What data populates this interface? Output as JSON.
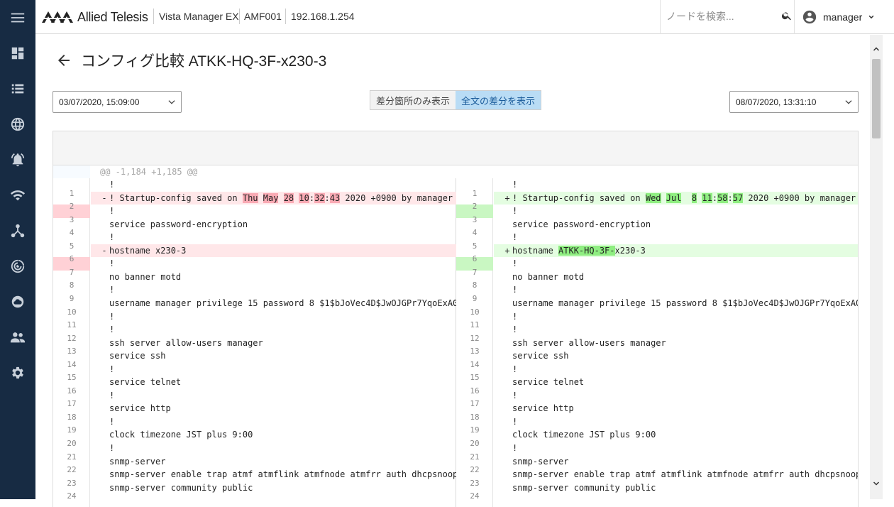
{
  "app": {
    "brand": "Allied Telesis",
    "product": "Vista Manager EX",
    "device": "AMF001",
    "ip": "192.168.1.254"
  },
  "search": {
    "placeholder": "ノードを検索..."
  },
  "user": {
    "name": "manager"
  },
  "sidebar": {
    "items": [
      "menu-icon",
      "dashboard-icon",
      "list-icon",
      "globe-icon",
      "alarm-icon",
      "wifi-icon",
      "topology-icon",
      "radar-icon",
      "cloud-icon",
      "users-icon",
      "settings-icon"
    ]
  },
  "page": {
    "title": "コンフィグ比較 ATKK-HQ-3F-x230-3",
    "left_date": "03/07/2020, 15:09:00",
    "right_date": "08/07/2020, 13:31:10",
    "toggle_diff_only": "差分箇所のみ表示",
    "toggle_full": "全文の差分を表示",
    "hunk": "@@ -1,184 +1,185 @@"
  },
  "colors": {
    "sidebar": "#172b43",
    "del_bg": "#ffe7e9",
    "add_bg": "#e4fde1",
    "del_hl": "#f9aab4",
    "add_hl": "#8fee81",
    "toggle_on": "#b9dcf5"
  },
  "diff": {
    "left": [
      {
        "n": "",
        "t": "!",
        "k": "ctx"
      },
      {
        "n": "1",
        "t": "! Startup-config saved on Thu May 28 10:32:43 2020 +0900 by manager",
        "k": "del"
      },
      {
        "n": "2",
        "t": "!",
        "k": "ctx"
      },
      {
        "n": "3",
        "t": "service password-encryption",
        "k": "ctx"
      },
      {
        "n": "4",
        "t": "!",
        "k": "ctx"
      },
      {
        "n": "5",
        "t": "hostname x230-3",
        "k": "del"
      },
      {
        "n": "6",
        "t": "!",
        "k": "ctx"
      },
      {
        "n": "7",
        "t": "no banner motd",
        "k": "ctx"
      },
      {
        "n": "8",
        "t": "!",
        "k": "ctx"
      },
      {
        "n": "9",
        "t": "username manager privilege 15 password 8 $1$bJoVec4D$JwOJGPr7YqoExA0",
        "k": "ctx"
      },
      {
        "n": "10",
        "t": "!",
        "k": "ctx"
      },
      {
        "n": "11",
        "t": "!",
        "k": "ctx"
      },
      {
        "n": "12",
        "t": "ssh server allow-users manager",
        "k": "ctx"
      },
      {
        "n": "13",
        "t": "service ssh",
        "k": "ctx"
      },
      {
        "n": "14",
        "t": "!",
        "k": "ctx"
      },
      {
        "n": "15",
        "t": "service telnet",
        "k": "ctx"
      },
      {
        "n": "16",
        "t": "!",
        "k": "ctx"
      },
      {
        "n": "17",
        "t": "service http",
        "k": "ctx"
      },
      {
        "n": "18",
        "t": "!",
        "k": "ctx"
      },
      {
        "n": "19",
        "t": "clock timezone JST plus 9:00",
        "k": "ctx"
      },
      {
        "n": "20",
        "t": "!",
        "k": "ctx"
      },
      {
        "n": "21",
        "t": "snmp-server",
        "k": "ctx"
      },
      {
        "n": "22",
        "t": "snmp-server enable trap atmf atmflink atmfnode atmfrr auth dhcpsnoop",
        "k": "ctx"
      },
      {
        "n": "23",
        "t": "snmp-server community public",
        "k": "ctx"
      },
      {
        "n": "24",
        "t": "",
        "k": "ctx"
      }
    ],
    "right": [
      {
        "n": "",
        "t": "!",
        "k": "ctx"
      },
      {
        "n": "1",
        "t": "! Startup-config saved on Wed Jul  8 11:58:57 2020 +0900 by manager",
        "k": "add"
      },
      {
        "n": "2",
        "t": "!",
        "k": "ctx"
      },
      {
        "n": "3",
        "t": "service password-encryption",
        "k": "ctx"
      },
      {
        "n": "4",
        "t": "!",
        "k": "ctx"
      },
      {
        "n": "5",
        "t": "hostname ATKK-HQ-3F-x230-3",
        "k": "add"
      },
      {
        "n": "6",
        "t": "!",
        "k": "ctx"
      },
      {
        "n": "7",
        "t": "no banner motd",
        "k": "ctx"
      },
      {
        "n": "8",
        "t": "!",
        "k": "ctx"
      },
      {
        "n": "9",
        "t": "username manager privilege 15 password 8 $1$bJoVec4D$JwOJGPr7YqoExA0",
        "k": "ctx"
      },
      {
        "n": "10",
        "t": "!",
        "k": "ctx"
      },
      {
        "n": "11",
        "t": "!",
        "k": "ctx"
      },
      {
        "n": "12",
        "t": "ssh server allow-users manager",
        "k": "ctx"
      },
      {
        "n": "13",
        "t": "service ssh",
        "k": "ctx"
      },
      {
        "n": "14",
        "t": "!",
        "k": "ctx"
      },
      {
        "n": "15",
        "t": "service telnet",
        "k": "ctx"
      },
      {
        "n": "16",
        "t": "!",
        "k": "ctx"
      },
      {
        "n": "17",
        "t": "service http",
        "k": "ctx"
      },
      {
        "n": "18",
        "t": "!",
        "k": "ctx"
      },
      {
        "n": "19",
        "t": "clock timezone JST plus 9:00",
        "k": "ctx"
      },
      {
        "n": "20",
        "t": "!",
        "k": "ctx"
      },
      {
        "n": "21",
        "t": "snmp-server",
        "k": "ctx"
      },
      {
        "n": "22",
        "t": "snmp-server enable trap atmf atmflink atmfnode atmfrr auth dhcpsnoop",
        "k": "ctx"
      },
      {
        "n": "23",
        "t": "snmp-server community public",
        "k": "ctx"
      },
      {
        "n": "24",
        "t": "",
        "k": "ctx"
      }
    ],
    "highlights": {
      "left_1": [
        "Thu",
        "May",
        "28",
        "10",
        "32",
        "43"
      ],
      "right_1": [
        "Wed",
        "Jul",
        "8",
        "11",
        "58",
        "57"
      ],
      "right_5": [
        "ATKK-HQ-3F-"
      ]
    }
  }
}
